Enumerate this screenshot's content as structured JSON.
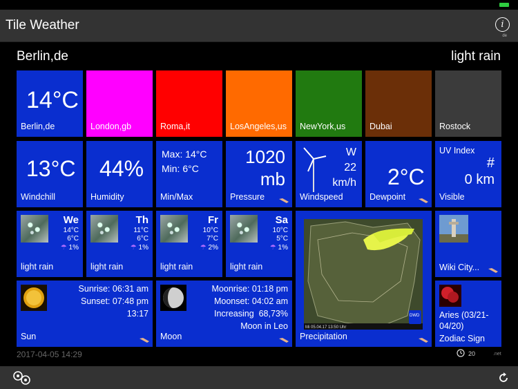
{
  "app": {
    "title": "Tile Weather",
    "info_sub": "de"
  },
  "location": {
    "city": "Berlin,de",
    "condition": "light rain"
  },
  "cities": [
    {
      "name": "Berlin,de",
      "temp": "14°C",
      "color": "#0a2ecf"
    },
    {
      "name": "London,gb",
      "color": "#ff00ff"
    },
    {
      "name": "Roma,it",
      "color": "#ff0000"
    },
    {
      "name": "LosAngeles,us",
      "color": "#ff6a00"
    },
    {
      "name": "NewYork,us",
      "color": "#217a10"
    },
    {
      "name": "Dubai",
      "color": "#6b2f08"
    },
    {
      "name": "Rostock",
      "color": "#3b3b3b"
    }
  ],
  "details": {
    "windchill": {
      "value": "13°C",
      "label": "Windchill"
    },
    "humidity": {
      "value": "44%",
      "label": "Humidity"
    },
    "minmax": {
      "max": "Max: 14°C",
      "min": "Min: 6°C",
      "label": "Min/Max"
    },
    "pressure": {
      "value": "1020",
      "unit": "mb",
      "label": "Pressure"
    },
    "wind": {
      "dir": "W",
      "speed": "22",
      "unit": "km/h",
      "label": "Windspeed"
    },
    "dewpoint": {
      "value": "2°C",
      "label": "Dewpoint"
    },
    "uv": {
      "title": "UV Index",
      "value": "#",
      "visibility": "0 km",
      "label": "Visible"
    }
  },
  "forecast": [
    {
      "day": "We",
      "high": "14°C",
      "low": "6°C",
      "pop": "1%",
      "desc": "light rain"
    },
    {
      "day": "Th",
      "high": "11°C",
      "low": "6°C",
      "pop": "1%",
      "desc": "light rain"
    },
    {
      "day": "Fr",
      "high": "10°C",
      "low": "7°C",
      "pop": "2%",
      "desc": "light rain"
    },
    {
      "day": "Sa",
      "high": "10°C",
      "low": "5°C",
      "pop": "1%",
      "desc": "light rain"
    }
  ],
  "sun": {
    "sunrise": "Sunrise: 06:31 am",
    "sunset": "Sunset: 07:48 pm",
    "daylength": "13:17",
    "label": "Sun"
  },
  "moon": {
    "moonrise": "Moonrise: 01:18 pm",
    "moonset": "Moonset: 04:02 am",
    "phase": "Increasing  68,73%",
    "sign": "Moon in Leo",
    "label": "Moon"
  },
  "precipitation": {
    "label": "Precipitation",
    "map_caption": "Mi 05.04.17  13:50 Uhr",
    "map_badge": "DWD"
  },
  "wiki": {
    "label": "Wiki City..."
  },
  "zodiac": {
    "sign": "Aries (03/21-",
    "range": "04/20)",
    "label": "Zodiac Sign"
  },
  "footer": {
    "date": "2017-04-05 14:29",
    "count": "20",
    "net": ".net"
  }
}
